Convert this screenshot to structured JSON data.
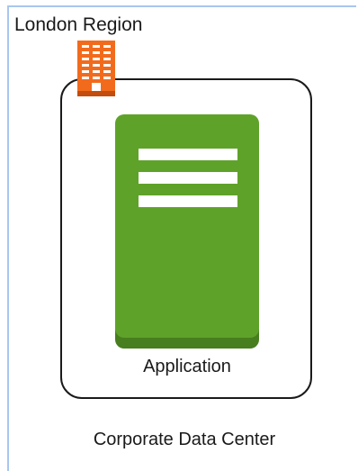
{
  "region": {
    "label": "London Region",
    "border_color": "#a9c6f0",
    "icon": "building-icon",
    "icon_color": "#f26b1d"
  },
  "data_center": {
    "label": "Corporate Data Center",
    "border_color": "#1a1a1a"
  },
  "application": {
    "label": "Application",
    "icon": "server-icon",
    "color": "#5fa22a",
    "shadow_color": "#477e1e"
  }
}
